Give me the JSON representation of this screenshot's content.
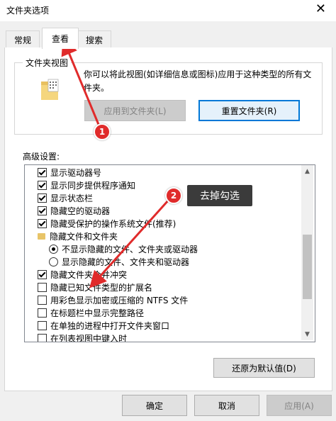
{
  "window": {
    "title": "文件夹选项",
    "close_glyph": "✕"
  },
  "tabs": [
    {
      "label": "常规"
    },
    {
      "label": "查看"
    },
    {
      "label": "搜索"
    }
  ],
  "folder_view": {
    "legend": "文件夹视图",
    "description": "你可以将此视图(如详细信息或图标)应用于这种类型的所有文件夹。",
    "apply_button": "应用到文件夹(L)",
    "reset_button": "重置文件夹(R)"
  },
  "advanced": {
    "label": "高级设置:",
    "items": [
      {
        "kind": "checkbox",
        "checked": true,
        "label": "显示驱动器号"
      },
      {
        "kind": "checkbox",
        "checked": true,
        "label": "显示同步提供程序通知"
      },
      {
        "kind": "checkbox",
        "checked": true,
        "label": "显示状态栏"
      },
      {
        "kind": "checkbox",
        "checked": true,
        "label": "隐藏空的驱动器"
      },
      {
        "kind": "checkbox",
        "checked": true,
        "label": "隐藏受保护的操作系统文件(推荐)"
      },
      {
        "kind": "folder",
        "label": "隐藏文件和文件夹"
      },
      {
        "kind": "radio",
        "selected": true,
        "label": "不显示隐藏的文件、文件夹或驱动器"
      },
      {
        "kind": "radio",
        "selected": false,
        "label": "显示隐藏的文件、文件夹和驱动器"
      },
      {
        "kind": "checkbox",
        "checked": true,
        "label": "隐藏文件夹合并冲突"
      },
      {
        "kind": "checkbox",
        "checked": false,
        "label": "隐藏已知文件类型的扩展名"
      },
      {
        "kind": "checkbox",
        "checked": false,
        "label": "用彩色显示加密或压缩的 NTFS 文件"
      },
      {
        "kind": "checkbox",
        "checked": false,
        "label": "在标题栏中显示完整路径"
      },
      {
        "kind": "checkbox",
        "checked": false,
        "label": "在单独的进程中打开文件夹窗口"
      },
      {
        "kind": "checkbox",
        "checked": false,
        "label": "在列表视图中键入时"
      }
    ],
    "restore_button": "还原为默认值(D)"
  },
  "footer": {
    "ok": "确定",
    "cancel": "取消",
    "apply": "应用(A)"
  },
  "annotations": {
    "badge1": "1",
    "badge2": "2",
    "note": "去掉勾选",
    "accent_color": "#e02b2b"
  }
}
